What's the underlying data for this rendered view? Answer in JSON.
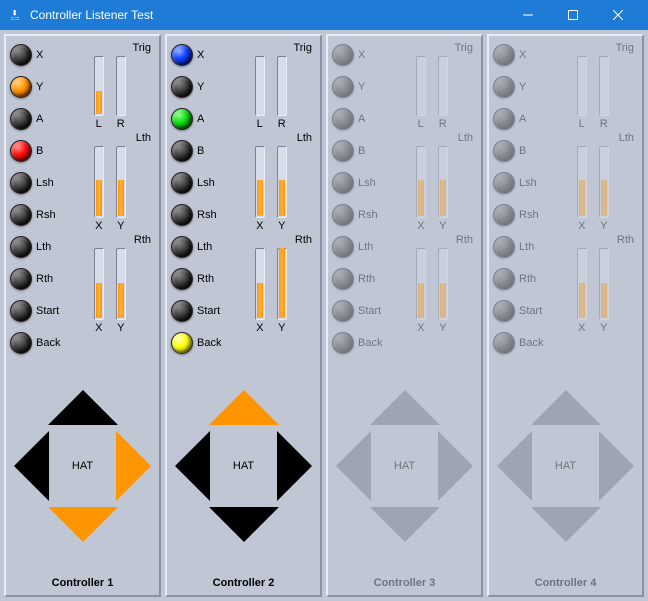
{
  "window": {
    "title": "Controller Listener Test"
  },
  "button_labels": [
    "X",
    "Y",
    "A",
    "B",
    "Lsh",
    "Rsh",
    "Lth",
    "Rth",
    "Start",
    "Back"
  ],
  "gauge_groups": [
    {
      "title": "Trig",
      "left": "L",
      "right": "R"
    },
    {
      "title": "Lth",
      "left": "X",
      "right": "Y"
    },
    {
      "title": "Rth",
      "left": "X",
      "right": "Y"
    }
  ],
  "hat_label": "HAT",
  "controllers": [
    {
      "name": "Controller 1",
      "active": true,
      "leds": [
        "off",
        "on-orange",
        "off",
        "on-red",
        "off",
        "off",
        "off",
        "off",
        "off",
        "off"
      ],
      "gauges": [
        {
          "l": 40,
          "r": 0
        },
        {
          "l": 52,
          "r": 52
        },
        {
          "l": 50,
          "r": 50
        }
      ],
      "hat": {
        "up": false,
        "down": true,
        "left": false,
        "right": true
      }
    },
    {
      "name": "Controller 2",
      "active": true,
      "leds": [
        "on-blue",
        "off",
        "on-green",
        "off",
        "off",
        "off",
        "off",
        "off",
        "off",
        "on-yellow"
      ],
      "gauges": [
        {
          "l": 0,
          "r": 0
        },
        {
          "l": 52,
          "r": 52
        },
        {
          "l": 50,
          "r": 100
        }
      ],
      "hat": {
        "up": true,
        "down": false,
        "left": false,
        "right": false
      }
    },
    {
      "name": "Controller 3",
      "active": false,
      "leds": [
        "off",
        "off",
        "off",
        "off",
        "off",
        "off",
        "off",
        "off",
        "off",
        "off"
      ],
      "gauges": [
        {
          "l": 0,
          "r": 0
        },
        {
          "l": 52,
          "r": 52
        },
        {
          "l": 50,
          "r": 50
        }
      ],
      "hat": {
        "up": false,
        "down": false,
        "left": false,
        "right": false
      }
    },
    {
      "name": "Controller 4",
      "active": false,
      "leds": [
        "off",
        "off",
        "off",
        "off",
        "off",
        "off",
        "off",
        "off",
        "off",
        "off"
      ],
      "gauges": [
        {
          "l": 0,
          "r": 0
        },
        {
          "l": 52,
          "r": 52
        },
        {
          "l": 50,
          "r": 50
        }
      ],
      "hat": {
        "up": false,
        "down": false,
        "left": false,
        "right": false
      }
    }
  ]
}
